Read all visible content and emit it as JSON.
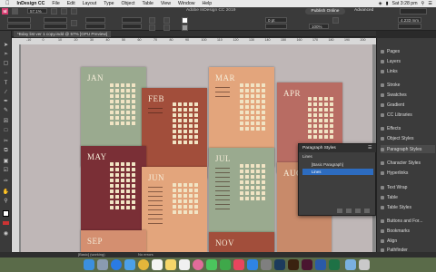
{
  "menubar": {
    "items": [
      "InDesign CC",
      "File",
      "Edit",
      "Layout",
      "Type",
      "Object",
      "Table",
      "View",
      "Window",
      "Help"
    ],
    "time": "Sat 3:28 pm"
  },
  "control": {
    "zoom": "57.1%",
    "app_title": "Adobe InDesign CC 2019",
    "publish_label": "Publish Online",
    "workspace_label": "Advanced",
    "stroke_value": "0 pt",
    "opacity_value": "100%",
    "measure_value": "4.233 mm"
  },
  "document": {
    "tab_label": "*Bday list ver 1 copy.indd @ 57% [GPU Preview]"
  },
  "ruler": {
    "ticks": [
      "-10",
      "0",
      "10",
      "20",
      "30",
      "40",
      "50",
      "60",
      "70",
      "80",
      "90",
      "100",
      "110",
      "120",
      "130",
      "140",
      "150",
      "160",
      "170",
      "180",
      "190",
      "200"
    ]
  },
  "months": {
    "jan": "JAN",
    "feb": "FEB",
    "mar": "MAR",
    "apr": "APR",
    "may": "MAY",
    "jun": "JUN",
    "jul": "JUL",
    "aug": "AUG",
    "sep": "SEP",
    "nov": "NOV"
  },
  "panels": {
    "items": [
      "Pages",
      "Layers",
      "Links",
      "Stroke",
      "Swatches",
      "Gradient",
      "CC Libraries",
      "Effects",
      "Object Styles",
      "Paragraph Styles",
      "Character Styles",
      "Hyperlinks",
      "Text Wrap",
      "Table",
      "Table Styles",
      "Buttons and For...",
      "Bookmarks",
      "Align",
      "Pathfinder"
    ]
  },
  "paragraph_styles": {
    "title": "Paragraph Styles",
    "section": "Lines",
    "rows": [
      "[Basic Paragraph]",
      "Lines"
    ]
  },
  "status": {
    "page_style": "[Basic] (working)",
    "errors": "No errors"
  },
  "colors": {
    "sage": "#9aaa8f",
    "rust": "#a24e3b",
    "peach": "#e3a57c",
    "dusty_rose": "#b86c63",
    "terracotta": "#c88a6a",
    "maroon": "#7a2f36",
    "salmon": "#d48f70",
    "para_selected": "#2d6cc0"
  }
}
